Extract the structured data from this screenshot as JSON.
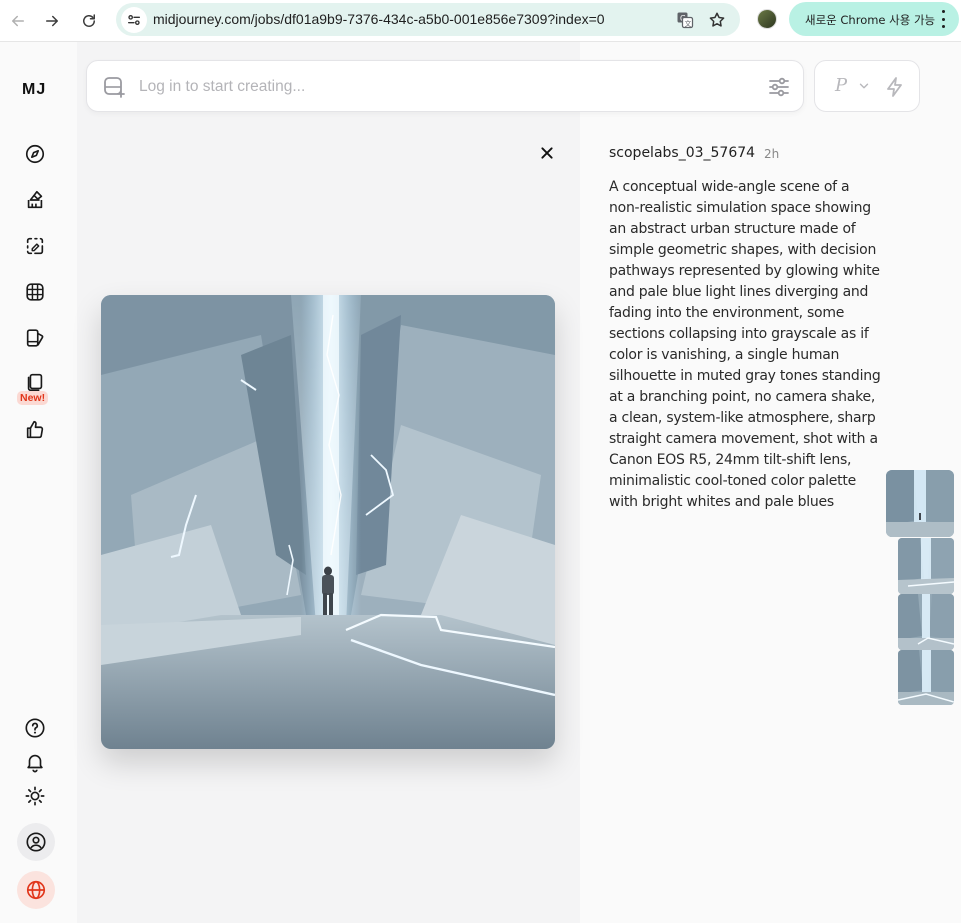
{
  "browser": {
    "url": "midjourney.com/jobs/df01a9b9-7376-434c-a5b0-001e856e7309?index=0",
    "chrome_promo": "새로운 Chrome 사용 가능"
  },
  "sidebar": {
    "logo": "MJ",
    "new_badge": "New!",
    "icons": [
      "compass-icon",
      "brush-icon",
      "edit-selection-icon",
      "grid-icon",
      "palette-icon",
      "cards-icon",
      "thumbs-up-icon",
      "help-icon",
      "bell-icon",
      "sun-icon",
      "user-circle-icon",
      "globe-icon"
    ]
  },
  "prompt_bar": {
    "placeholder": "Log in to start creating...",
    "mode_label": "P"
  },
  "job": {
    "author": "scopelabs_03_57674",
    "age": "2h",
    "prompt": "A conceptual wide-angle scene of a non-realistic simulation space showing an abstract urban structure made of simple geometric shapes, with decision pathways represented by glowing white and pale blue light lines diverging and fading into the environment, some sections collapsing into grayscale as if color is vanishing, a single human silhouette in muted gray tones standing at a branching point, no camera shake, a clean, system-like atmosphere, sharp straight camera movement, shot with a Canon EOS R5, 24mm tilt-shift lens, minimalistic cool-toned color palette with bright whites and pale blues"
  },
  "colors": {
    "accent_red": "#e1361b",
    "omnibox_bg": "#e3f3ef",
    "promo_bg": "#b9f1e4"
  }
}
